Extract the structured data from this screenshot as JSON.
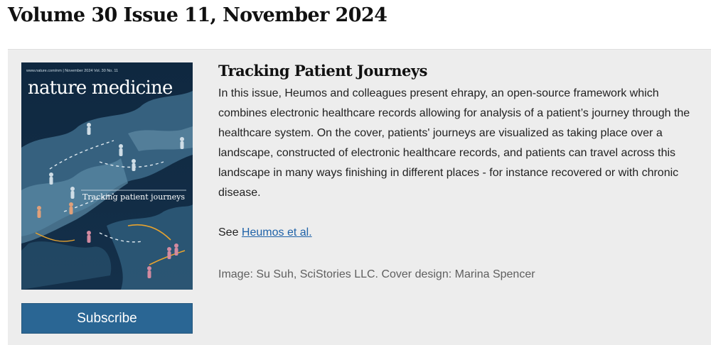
{
  "page": {
    "title": "Volume 30 Issue 11, November 2024"
  },
  "cover": {
    "url_line": "www.nature.com/nm | November 2024 Vol. 30 No. 11",
    "journal_name": "nature medicine",
    "cover_line": "Tracking patient journeys",
    "colors": {
      "background": "#16324a",
      "land": "#3d6b8a",
      "accent": "#e8a32e"
    }
  },
  "subscribe": {
    "label": "Subscribe",
    "color": "#2a6694"
  },
  "article": {
    "title": "Tracking Patient Journeys",
    "description": "In this issue, Heumos and colleagues present ehrapy, an open-source framework which combines electronic healthcare records allowing for analysis of a patient’s journey through the healthcare system. On the cover, patients' journeys are visualized as taking place over a landscape, constructed of electronic healthcare records, and patients can travel across this landscape in many ways finishing in different places - for instance recovered or with chronic disease.",
    "see_prefix": "See",
    "see_link": "Heumos et al.",
    "credit": "Image: Su Suh, SciStories LLC. Cover design: Marina Spencer"
  }
}
